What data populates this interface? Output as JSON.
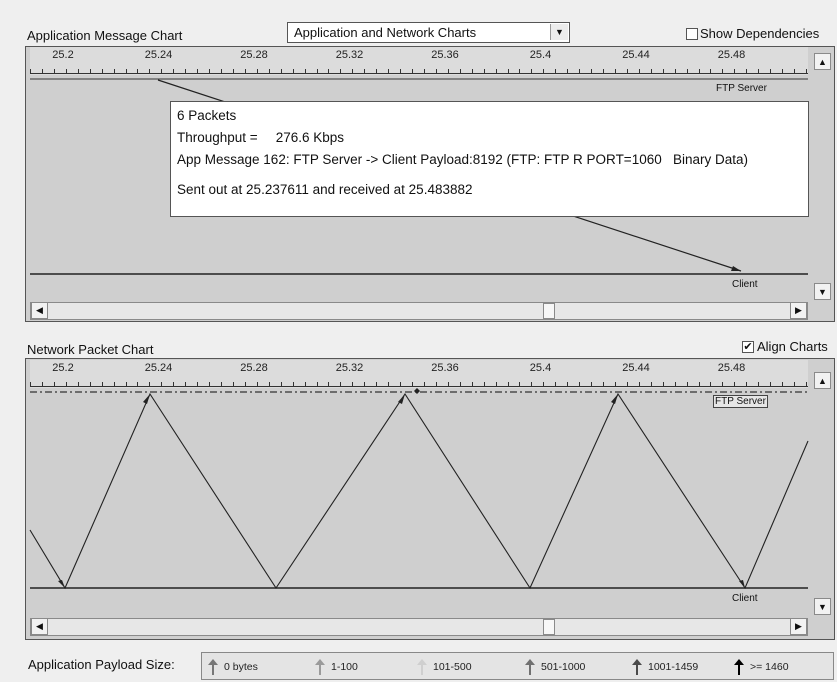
{
  "top_panel": {
    "title": "Application Message Chart",
    "view_select": {
      "value": "Application and Network Charts"
    },
    "show_dependencies": {
      "label": "Show Dependencies",
      "checked": false
    },
    "ruler_ticks": [
      "25.2",
      "25.24",
      "25.28",
      "25.32",
      "25.36",
      "25.4",
      "25.44",
      "25.48"
    ],
    "lanes": {
      "server": "FTP Server",
      "client": "Client"
    },
    "tooltip": {
      "line1": "6 Packets",
      "line2_label": "Throughput =",
      "line2_value": "276.6 Kbps",
      "line3": "App Message 162: FTP Server -> Client Payload:8192 (FTP: FTP R PORT=1060   Binary Data)",
      "line4": "Sent out at 25.237611 and received at 25.483882"
    }
  },
  "bottom_panel": {
    "title": "Network Packet Chart",
    "align_charts": {
      "label": "Align Charts",
      "checked": true
    },
    "ruler_ticks": [
      "25.2",
      "25.24",
      "25.28",
      "25.32",
      "25.36",
      "25.4",
      "25.44",
      "25.48"
    ],
    "lanes": {
      "server": "FTP Server",
      "client": "Client"
    }
  },
  "legend": {
    "title": "Application Payload Size:",
    "items": [
      {
        "label": "0 bytes",
        "color": "#777777"
      },
      {
        "label": "1-100",
        "color": "#9a9a9a"
      },
      {
        "label": "101-500",
        "color": "#cfcfcf"
      },
      {
        "label": "501-1000",
        "color": "#707070"
      },
      {
        "label": "1001-1459",
        "color": "#4a4a4a"
      },
      {
        "label": ">= 1460",
        "color": "#000000"
      }
    ]
  }
}
